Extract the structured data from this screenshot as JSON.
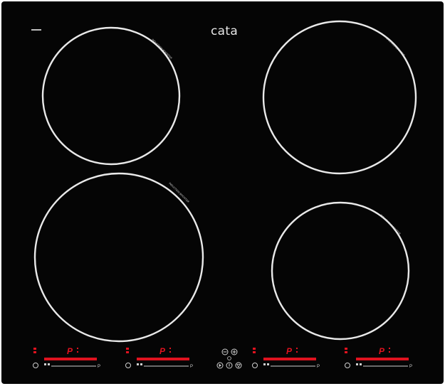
{
  "cooktop": {
    "brand": "cata",
    "zone_label": "INDUCTION BOOSTER",
    "watermark": "",
    "colors": {
      "glass": "#050505",
      "zone_ring": "#e9e9e9",
      "display_red": "#e0121f",
      "control_gray": "#cfcfcf"
    }
  },
  "zones": [
    {
      "id": "rear-left",
      "label": "INDUCTION BOOSTER"
    },
    {
      "id": "front-left",
      "label": "INDUCTION BOOSTER"
    },
    {
      "id": "rear-right",
      "label": "INDUCTION BOOSTER"
    },
    {
      "id": "front-right",
      "label": "INDUCTION BOOSTER"
    }
  ],
  "controls": {
    "zone_panels": [
      {
        "zone": "front-left",
        "display": "P",
        "power_level": 1.0
      },
      {
        "zone": "rear-left",
        "display": "P",
        "power_level": 1.0
      },
      {
        "zone": "rear-right",
        "display": "P",
        "power_level": 1.0
      },
      {
        "zone": "front-right",
        "display": "P",
        "power_level": 1.0
      }
    ],
    "center_panel": {
      "icons": [
        "minus-icon",
        "plus-icon",
        "timer-icon",
        "play-icon",
        "power-icon",
        "lock-icon"
      ]
    }
  }
}
